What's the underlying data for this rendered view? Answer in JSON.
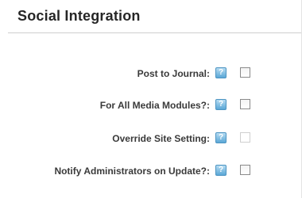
{
  "section": {
    "title": "Social Integration"
  },
  "settings": [
    {
      "label": "Post to Journal:",
      "help_icon": "help-icon",
      "help_glyph": "?",
      "checked": false,
      "disabled": false
    },
    {
      "label": "For All Media Modules?:",
      "help_icon": "help-icon",
      "help_glyph": "?",
      "checked": false,
      "disabled": false
    },
    {
      "label": "Override Site Setting:",
      "help_icon": "help-icon",
      "help_glyph": "?",
      "checked": false,
      "disabled": true
    },
    {
      "label": "Notify Administrators on Update?:",
      "help_icon": "help-icon",
      "help_glyph": "?",
      "checked": false,
      "disabled": false
    }
  ],
  "colors": {
    "title_text": "#262626",
    "label_text": "#3a3a3a",
    "help_icon_bg": "#5aa7d6",
    "divider": "#cfcfcf"
  }
}
